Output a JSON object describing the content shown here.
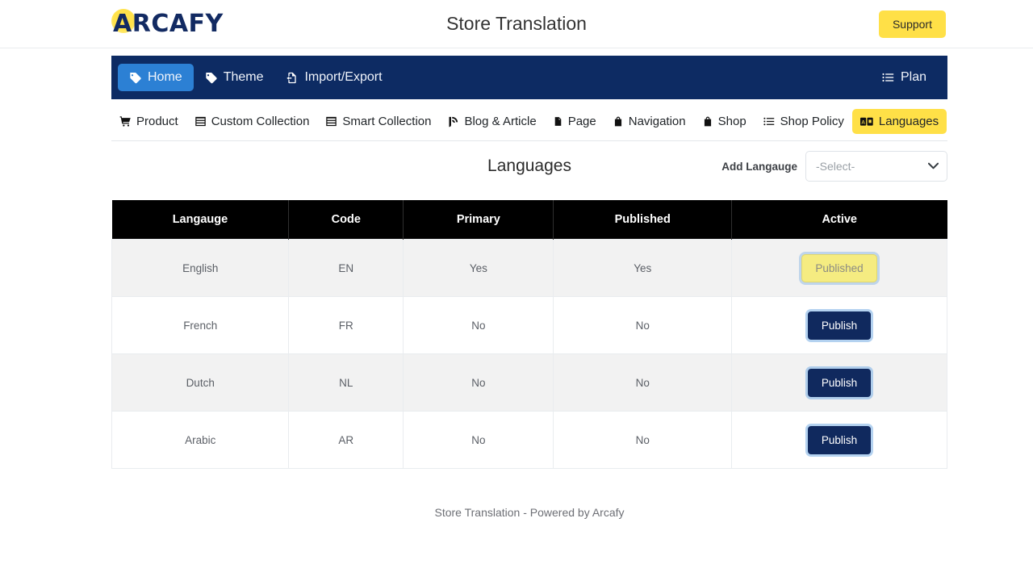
{
  "header": {
    "logo_text": "ARCAFY",
    "logo_icon": "arcafy-logo-mark",
    "title": "Store Translation",
    "support_label": "Support"
  },
  "navbar": {
    "items": [
      {
        "label": "Home",
        "icon": "tag-icon",
        "active": true
      },
      {
        "label": "Theme",
        "icon": "tag-icon",
        "active": false
      },
      {
        "label": "Import/Export",
        "icon": "file-import-icon",
        "active": false
      }
    ],
    "right": {
      "label": "Plan",
      "icon": "list-icon"
    }
  },
  "tabs": [
    {
      "label": "Product",
      "icon": "shopping-cart-icon",
      "active": false
    },
    {
      "label": "Custom Collection",
      "icon": "list-alt-icon",
      "active": false
    },
    {
      "label": "Smart Collection",
      "icon": "list-alt-icon",
      "active": false
    },
    {
      "label": "Blog & Article",
      "icon": "blog-icon",
      "active": false
    },
    {
      "label": "Page",
      "icon": "file-icon",
      "active": false
    },
    {
      "label": "Navigation",
      "icon": "bag-icon",
      "active": false
    },
    {
      "label": "Shop",
      "icon": "bag-icon",
      "active": false
    },
    {
      "label": "Shop Policy",
      "icon": "list-icon",
      "active": false
    },
    {
      "label": "Languages",
      "icon": "language-icon",
      "active": true
    }
  ],
  "section": {
    "title": "Languages",
    "add_language_label": "Add Langauge",
    "select_value": "-Select-",
    "select_caret_icon": "chevron-down-icon"
  },
  "table": {
    "columns": [
      "Langauge",
      "Code",
      "Primary",
      "Published",
      "Active"
    ],
    "rows": [
      {
        "language": "English",
        "code": "EN",
        "primary": "Yes",
        "published": "Yes",
        "action": "Published",
        "action_state": "published"
      },
      {
        "language": "French",
        "code": "FR",
        "primary": "No",
        "published": "No",
        "action": "Publish",
        "action_state": "publish"
      },
      {
        "language": "Dutch",
        "code": "NL",
        "primary": "No",
        "published": "No",
        "action": "Publish",
        "action_state": "publish"
      },
      {
        "language": "Arabic",
        "code": "AR",
        "primary": "No",
        "published": "No",
        "action": "Publish",
        "action_state": "publish"
      }
    ]
  },
  "footer": {
    "text": "Store Translation - Powered by Arcafy"
  },
  "colors": {
    "navy": "#0d2b63",
    "nav_active_blue": "#2c80d4",
    "accent_yellow": "#ffe047",
    "published_yellow": "#f5ec81",
    "publish_navy": "#10295e",
    "table_header_black": "#000000",
    "row_odd": "#f2f2f2"
  }
}
